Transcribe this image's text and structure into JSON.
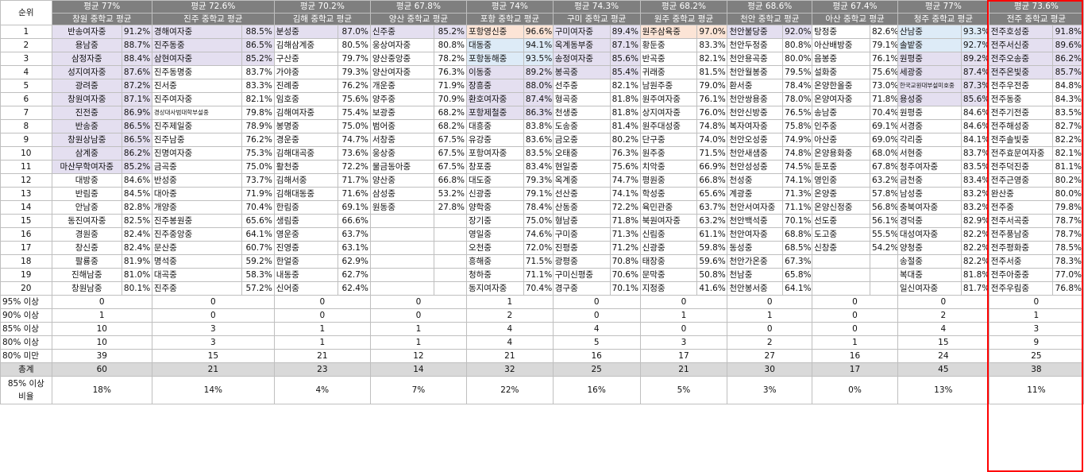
{
  "rank_header": "순위",
  "columns": [
    {
      "avg": "평균 77%",
      "name": "창원 중학교 평균"
    },
    {
      "avg": "평균 72.6%",
      "name": "진주 중학교 평균"
    },
    {
      "avg": "평균 70.2%",
      "name": "김해 중학교 평균"
    },
    {
      "avg": "평균 67.8%",
      "name": "양산 중학교 평균"
    },
    {
      "avg": "평균 74%",
      "name": "포항 중학교 평균"
    },
    {
      "avg": "평균 74.3%",
      "name": "구미 중학교 평균"
    },
    {
      "avg": "평균 68.2%",
      "name": "원주 중학교 평균"
    },
    {
      "avg": "평균 68.6%",
      "name": "천안 중학교 평균"
    },
    {
      "avg": "평균 67.4%",
      "name": "아산 중학교 평균"
    },
    {
      "avg": "평균 77%",
      "name": "청주 중학교 평균"
    },
    {
      "avg": "평균 73.6%",
      "name": "전주 중학교 평균"
    }
  ],
  "rows": [
    {
      "rank": "1",
      "cells": [
        [
          "반송여자중",
          "91.2%"
        ],
        [
          "경해여자중",
          "88.5%"
        ],
        [
          "분성중",
          "87.0%"
        ],
        [
          "신주중",
          "85.2%"
        ],
        [
          "포항영신중",
          "96.6%"
        ],
        [
          "구미여자중",
          "89.4%"
        ],
        [
          "원주삼육중",
          "97.0%"
        ],
        [
          "천안불당중",
          "92.0%"
        ],
        [
          "탕정중",
          "82.6%"
        ],
        [
          "산남중",
          "93.3%"
        ],
        [
          "전주호성중",
          "91.8%"
        ]
      ]
    },
    {
      "rank": "2",
      "cells": [
        [
          "용남중",
          "88.7%"
        ],
        [
          "진주동중",
          "86.5%"
        ],
        [
          "김해삼계중",
          "80.5%"
        ],
        [
          "웅상여자중",
          "80.8%"
        ],
        [
          "대동중",
          "94.1%"
        ],
        [
          "옥계동부중",
          "87.1%"
        ],
        [
          "황둔중",
          "83.3%"
        ],
        [
          "천안두정중",
          "80.8%"
        ],
        [
          "아산배방중",
          "79.1%"
        ],
        [
          "솔밭중",
          "92.7%"
        ],
        [
          "전주서신중",
          "89.6%"
        ]
      ]
    },
    {
      "rank": "3",
      "cells": [
        [
          "삼정자중",
          "88.4%"
        ],
        [
          "삼현여자중",
          "85.2%"
        ],
        [
          "구산중",
          "79.7%"
        ],
        [
          "양산중앙중",
          "78.2%"
        ],
        [
          "포항동해중",
          "93.5%"
        ],
        [
          "송정여자중",
          "85.6%"
        ],
        [
          "반곡중",
          "82.1%"
        ],
        [
          "천안용곡중",
          "80.0%"
        ],
        [
          "음봉중",
          "76.1%"
        ],
        [
          "원평중",
          "89.2%"
        ],
        [
          "전주오송중",
          "86.2%"
        ]
      ]
    },
    {
      "rank": "4",
      "cells": [
        [
          "성지여자중",
          "87.6%"
        ],
        [
          "진주동명중",
          "83.7%"
        ],
        [
          "가야중",
          "79.3%"
        ],
        [
          "양산여자중",
          "76.3%"
        ],
        [
          "이동중",
          "89.2%"
        ],
        [
          "봉곡중",
          "85.4%"
        ],
        [
          "귀래중",
          "81.5%"
        ],
        [
          "천안월봉중",
          "79.5%"
        ],
        [
          "설화중",
          "75.6%"
        ],
        [
          "세광중",
          "87.4%"
        ],
        [
          "전주온빛중",
          "85.7%"
        ]
      ]
    },
    {
      "rank": "5",
      "cells": [
        [
          "광려중",
          "87.2%"
        ],
        [
          "진서중",
          "83.3%"
        ],
        [
          "진례중",
          "76.2%"
        ],
        [
          "개운중",
          "71.9%"
        ],
        [
          "장흥중",
          "88.0%"
        ],
        [
          "선주중",
          "82.1%"
        ],
        [
          "남원주중",
          "79.0%"
        ],
        [
          "환서중",
          "78.4%"
        ],
        [
          "온양한올중",
          "73.0%"
        ],
        [
          "한국교원대부설미호중",
          "87.3%"
        ],
        [
          "전주우전중",
          "84.8%"
        ]
      ]
    },
    {
      "rank": "6",
      "cells": [
        [
          "창원여자중",
          "87.1%"
        ],
        [
          "진주여자중",
          "82.1%"
        ],
        [
          "임호중",
          "75.6%"
        ],
        [
          "양주중",
          "70.9%"
        ],
        [
          "환호여자중",
          "87.4%"
        ],
        [
          "형곡중",
          "81.8%"
        ],
        [
          "원주여자중",
          "76.1%"
        ],
        [
          "천안쌍용중",
          "78.0%"
        ],
        [
          "온양여자중",
          "71.8%"
        ],
        [
          "용성중",
          "85.6%"
        ],
        [
          "전주동중",
          "84.3%"
        ]
      ]
    },
    {
      "rank": "7",
      "cells": [
        [
          "진전중",
          "86.9%"
        ],
        [
          "경상대사범대학부설중",
          "79.8%"
        ],
        [
          "김해여자중",
          "75.4%"
        ],
        [
          "보광중",
          "68.2%"
        ],
        [
          "포항제철중",
          "86.3%"
        ],
        [
          "천생중",
          "81.8%"
        ],
        [
          "상지여자중",
          "76.0%"
        ],
        [
          "천안신방중",
          "76.5%"
        ],
        [
          "송남중",
          "70.4%"
        ],
        [
          "원평중",
          "84.6%"
        ],
        [
          "전주기전중",
          "83.5%"
        ]
      ]
    },
    {
      "rank": "8",
      "cells": [
        [
          "반송중",
          "86.5%"
        ],
        [
          "진주제일중",
          "78.9%"
        ],
        [
          "봉명중",
          "75.0%"
        ],
        [
          "범어중",
          "68.2%"
        ],
        [
          "대흥중",
          "83.8%"
        ],
        [
          "도송중",
          "81.4%"
        ],
        [
          "원주대성중",
          "74.8%"
        ],
        [
          "복자여자중",
          "75.8%"
        ],
        [
          "인주중",
          "69.1%"
        ],
        [
          "서경중",
          "84.6%"
        ],
        [
          "전주해성중",
          "82.7%"
        ]
      ]
    },
    {
      "rank": "9",
      "cells": [
        [
          "창원상남중",
          "86.5%"
        ],
        [
          "진주남중",
          "76.2%"
        ],
        [
          "경운중",
          "74.7%"
        ],
        [
          "서창중",
          "67.5%"
        ],
        [
          "유강중",
          "83.6%"
        ],
        [
          "금오중",
          "80.2%"
        ],
        [
          "단구중",
          "74.0%"
        ],
        [
          "천안오성중",
          "74.9%"
        ],
        [
          "아산중",
          "69.0%"
        ],
        [
          "각리중",
          "84.1%"
        ],
        [
          "전주솔빛중",
          "82.2%"
        ]
      ]
    },
    {
      "rank": "10",
      "cells": [
        [
          "삼계중",
          "86.2%"
        ],
        [
          "진명여자중",
          "75.3%"
        ],
        [
          "김해대곡중",
          "73.6%"
        ],
        [
          "웅상중",
          "67.5%"
        ],
        [
          "포항여자중",
          "83.5%"
        ],
        [
          "오태중",
          "76.3%"
        ],
        [
          "원주중",
          "71.5%"
        ],
        [
          "천안새샘중",
          "74.8%"
        ],
        [
          "온양용화중",
          "68.0%"
        ],
        [
          "서현중",
          "83.7%"
        ],
        [
          "전주효문여자중",
          "82.1%"
        ]
      ]
    },
    {
      "rank": "11",
      "cells": [
        [
          "마산무학여자중",
          "85.2%"
        ],
        [
          "금곡중",
          "75.0%"
        ],
        [
          "활천중",
          "72.2%"
        ],
        [
          "물금동아중",
          "67.5%"
        ],
        [
          "창포중",
          "83.4%"
        ],
        [
          "현일중",
          "75.6%"
        ],
        [
          "치악중",
          "66.9%"
        ],
        [
          "천안성성중",
          "74.5%"
        ],
        [
          "둔포중",
          "67.8%"
        ],
        [
          "청주여자중",
          "83.5%"
        ],
        [
          "전주덕진중",
          "81.1%"
        ]
      ]
    },
    {
      "rank": "12",
      "cells": [
        [
          "대방중",
          "84.6%"
        ],
        [
          "반성중",
          "73.7%"
        ],
        [
          "김해서중",
          "71.7%"
        ],
        [
          "양산중",
          "66.8%"
        ],
        [
          "대도중",
          "79.3%"
        ],
        [
          "옥계중",
          "74.7%"
        ],
        [
          "평원중",
          "66.8%"
        ],
        [
          "천성중",
          "74.1%"
        ],
        [
          "영인중",
          "63.2%"
        ],
        [
          "금천중",
          "83.4%"
        ],
        [
          "전주근영중",
          "80.2%"
        ]
      ]
    },
    {
      "rank": "13",
      "cells": [
        [
          "반림중",
          "84.5%"
        ],
        [
          "대아중",
          "71.9%"
        ],
        [
          "김해대동중",
          "71.6%"
        ],
        [
          "삼성중",
          "53.2%"
        ],
        [
          "신광중",
          "79.1%"
        ],
        [
          "선산중",
          "74.1%"
        ],
        [
          "학성중",
          "65.6%"
        ],
        [
          "계광중",
          "71.3%"
        ],
        [
          "온양중",
          "57.8%"
        ],
        [
          "남성중",
          "83.2%"
        ],
        [
          "완산중",
          "80.0%"
        ]
      ]
    },
    {
      "rank": "14",
      "cells": [
        [
          "안남중",
          "82.8%"
        ],
        [
          "개양중",
          "70.4%"
        ],
        [
          "한림중",
          "69.1%"
        ],
        [
          "원동중",
          "27.8%"
        ],
        [
          "양학중",
          "78.4%"
        ],
        [
          "산동중",
          "72.2%"
        ],
        [
          "육민관중",
          "63.7%"
        ],
        [
          "천안서여자중",
          "71.1%"
        ],
        [
          "온양신정중",
          "56.8%"
        ],
        [
          "충북여자중",
          "83.2%"
        ],
        [
          "전주중",
          "79.8%"
        ]
      ]
    },
    {
      "rank": "15",
      "cells": [
        [
          "동진여자중",
          "82.5%"
        ],
        [
          "진주봉원중",
          "65.6%"
        ],
        [
          "생림중",
          "66.6%"
        ],
        [
          "",
          ""
        ],
        [
          "장기중",
          "75.0%"
        ],
        [
          "형남중",
          "71.8%"
        ],
        [
          "북원여자중",
          "63.2%"
        ],
        [
          "천안백석중",
          "70.1%"
        ],
        [
          "선도중",
          "56.1%"
        ],
        [
          "경덕중",
          "82.9%"
        ],
        [
          "전주서곡중",
          "78.7%"
        ]
      ]
    },
    {
      "rank": "16",
      "cells": [
        [
          "경원중",
          "82.4%"
        ],
        [
          "진주중앙중",
          "64.1%"
        ],
        [
          "영운중",
          "63.7%"
        ],
        [
          "",
          ""
        ],
        [
          "영일중",
          "74.6%"
        ],
        [
          "구미중",
          "71.3%"
        ],
        [
          "신림중",
          "61.1%"
        ],
        [
          "천안여자중",
          "68.8%"
        ],
        [
          "도고중",
          "55.5%"
        ],
        [
          "대성여자중",
          "82.2%"
        ],
        [
          "전주풍남중",
          "78.7%"
        ]
      ]
    },
    {
      "rank": "17",
      "cells": [
        [
          "창신중",
          "82.4%"
        ],
        [
          "문산중",
          "60.7%"
        ],
        [
          "진영중",
          "63.1%"
        ],
        [
          "",
          ""
        ],
        [
          "오천중",
          "72.0%"
        ],
        [
          "진평중",
          "71.2%"
        ],
        [
          "신광중",
          "59.8%"
        ],
        [
          "동성중",
          "68.5%"
        ],
        [
          "신창중",
          "54.2%"
        ],
        [
          "양청중",
          "82.2%"
        ],
        [
          "전주평화중",
          "78.5%"
        ]
      ]
    },
    {
      "rank": "18",
      "cells": [
        [
          "팔룡중",
          "81.9%"
        ],
        [
          "명석중",
          "59.2%"
        ],
        [
          "한얼중",
          "62.9%"
        ],
        [
          "",
          ""
        ],
        [
          "흥해중",
          "71.5%"
        ],
        [
          "광평중",
          "70.8%"
        ],
        [
          "태장중",
          "59.6%"
        ],
        [
          "천안가온중",
          "67.3%"
        ],
        [
          "",
          ""
        ],
        [
          "송절중",
          "82.2%"
        ],
        [
          "전주서중",
          "78.3%"
        ]
      ]
    },
    {
      "rank": "19",
      "cells": [
        [
          "진해남중",
          "81.0%"
        ],
        [
          "대곡중",
          "58.3%"
        ],
        [
          "내동중",
          "62.7%"
        ],
        [
          "",
          ""
        ],
        [
          "청하중",
          "71.1%"
        ],
        [
          "구미신평중",
          "70.6%"
        ],
        [
          "문막중",
          "50.8%"
        ],
        [
          "천남중",
          "65.8%"
        ],
        [
          "",
          ""
        ],
        [
          "복대중",
          "81.8%"
        ],
        [
          "전주아중중",
          "77.0%"
        ]
      ]
    },
    {
      "rank": "20",
      "cells": [
        [
          "창원남중",
          "80.1%"
        ],
        [
          "진주중",
          "57.2%"
        ],
        [
          "신어중",
          "62.4%"
        ],
        [
          "",
          ""
        ],
        [
          "동지여자중",
          "70.4%"
        ],
        [
          "경구중",
          "70.1%"
        ],
        [
          "지정중",
          "41.6%"
        ],
        [
          "천안봉서중",
          "64.1%"
        ],
        [
          "",
          ""
        ],
        [
          "일신여자중",
          "81.7%"
        ],
        [
          "전주우림중",
          "76.8%"
        ]
      ]
    }
  ],
  "summary": [
    {
      "label": "95% 이상",
      "values": [
        "0",
        "0",
        "0",
        "0",
        "1",
        "0",
        "0",
        "0",
        "0",
        "0",
        "0"
      ]
    },
    {
      "label": "90% 이상",
      "values": [
        "1",
        "0",
        "0",
        "0",
        "2",
        "0",
        "1",
        "1",
        "0",
        "2",
        "1"
      ]
    },
    {
      "label": "85% 이상",
      "values": [
        "10",
        "3",
        "1",
        "1",
        "4",
        "4",
        "0",
        "0",
        "0",
        "4",
        "3"
      ]
    },
    {
      "label": "80% 이상",
      "values": [
        "10",
        "3",
        "1",
        "1",
        "4",
        "5",
        "3",
        "2",
        "1",
        "15",
        "9"
      ]
    },
    {
      "label": "80% 미만",
      "values": [
        "39",
        "15",
        "21",
        "12",
        "21",
        "16",
        "17",
        "27",
        "16",
        "24",
        "25"
      ]
    },
    {
      "label": "총계",
      "values": [
        "60",
        "21",
        "23",
        "14",
        "32",
        "25",
        "21",
        "30",
        "17",
        "45",
        "38"
      ]
    }
  ],
  "ratio": {
    "label_line1": "85% 이상",
    "label_line2": "비율",
    "values": [
      "18%",
      "14%",
      "4%",
      "7%",
      "22%",
      "16%",
      "5%",
      "3%",
      "0%",
      "13%",
      "11%"
    ]
  },
  "colors": {
    "header_bg": "#7f7f7f",
    "highlight_purple": "#e4dff0",
    "highlight_blue": "#ddebf7",
    "highlight_orange": "#fce4d6",
    "total_bg": "#d9d9d9",
    "selection_border": "#ff0000"
  }
}
